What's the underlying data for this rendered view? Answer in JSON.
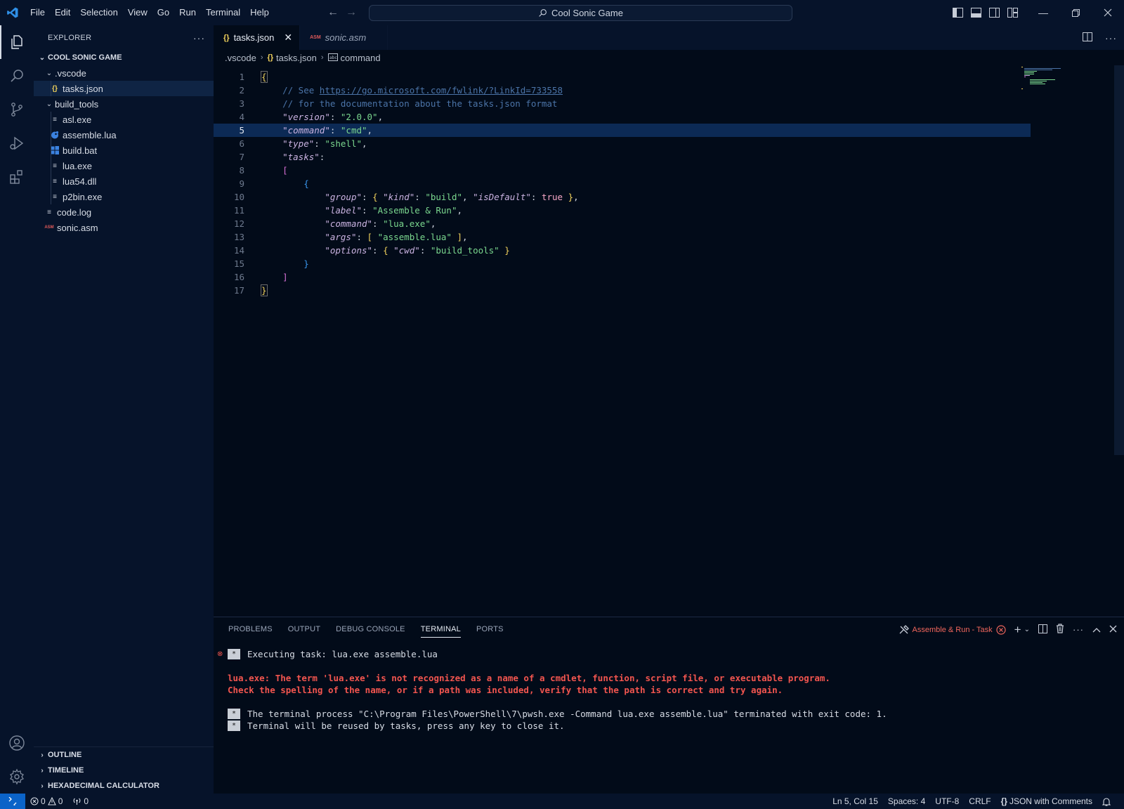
{
  "menu": [
    "File",
    "Edit",
    "Selection",
    "View",
    "Go",
    "Run",
    "Terminal",
    "Help"
  ],
  "command_center": "Cool Sonic Game",
  "sidebar": {
    "title": "EXPLORER",
    "more": "···",
    "folder": "COOL SONIC GAME",
    "tree": [
      {
        "label": ".vscode",
        "type": "folder"
      },
      {
        "label": "tasks.json",
        "type": "json"
      },
      {
        "label": "build_tools",
        "type": "folder"
      },
      {
        "label": "asl.exe",
        "type": "file"
      },
      {
        "label": "assemble.lua",
        "type": "lua"
      },
      {
        "label": "build.bat",
        "type": "bat"
      },
      {
        "label": "lua.exe",
        "type": "file"
      },
      {
        "label": "lua54.dll",
        "type": "file"
      },
      {
        "label": "p2bin.exe",
        "type": "file"
      },
      {
        "label": "code.log",
        "type": "file"
      },
      {
        "label": "sonic.asm",
        "type": "asm"
      }
    ],
    "sections": [
      "OUTLINE",
      "TIMELINE",
      "HEXADECIMAL CALCULATOR"
    ]
  },
  "tabs": [
    {
      "label": "tasks.json",
      "icon": "{}"
    },
    {
      "label": "sonic.asm",
      "icon": "ASM"
    }
  ],
  "breadcrumb": [
    ".vscode",
    "tasks.json",
    "command"
  ],
  "code": {
    "line_numbers": [
      "1",
      "2",
      "3",
      "4",
      "5",
      "6",
      "7",
      "8",
      "9",
      "10",
      "11",
      "12",
      "13",
      "14",
      "15",
      "16",
      "17"
    ],
    "l1": "{",
    "l2a": "// See ",
    "l2b": "https://go.microsoft.com/fwlink/?LinkId=733558",
    "l3": "// for the documentation about the tasks.json format",
    "l4k": "\"version\"",
    "l4v": "\"2.0.0\"",
    "l5k": "\"command\"",
    "l5v": "\"cmd\"",
    "l6k": "\"type\"",
    "l6v": "\"shell\"",
    "l7k": "\"tasks\"",
    "l8": "[",
    "l9": "{",
    "l10k": "\"group\"",
    "l10k2": "\"kind\"",
    "l10v2": "\"build\"",
    "l10k3": "\"isDefault\"",
    "l10v3": "true",
    "l11k": "\"label\"",
    "l11v": "\"Assemble & Run\"",
    "l12k": "\"command\"",
    "l12v": "\"lua.exe\"",
    "l13k": "\"args\"",
    "l13v": "\"assemble.lua\"",
    "l14k": "\"options\"",
    "l14k2": "\"cwd\"",
    "l14v2": "\"build_tools\"",
    "l15": "}",
    "l16": "]",
    "l17": "}"
  },
  "panel": {
    "tabs": [
      "PROBLEMS",
      "OUTPUT",
      "DEBUG CONSOLE",
      "TERMINAL",
      "PORTS"
    ],
    "task": "Assemble & Run - Task",
    "terminal": {
      "exec": "Executing task: lua.exe assemble.lua",
      "err1": "lua.exe: The term 'lua.exe' is not recognized as a name of a cmdlet, function, script file, or executable program.",
      "err2": "Check the spelling of the name, or if a path was included, verify that the path is correct and try again.",
      "info1": "The terminal process \"C:\\Program Files\\PowerShell\\7\\pwsh.exe -Command lua.exe assemble.lua\" terminated with exit code: 1.",
      "info2": "Terminal will be reused by tasks, press any key to close it."
    }
  },
  "status": {
    "errors": "0",
    "warnings": "0",
    "ports": "0",
    "position": "Ln 5, Col 15",
    "spaces": "Spaces: 4",
    "encoding": "UTF-8",
    "eol": "CRLF",
    "language": "JSON with Comments"
  },
  "colors": {
    "accent": "#0b63c8",
    "background": "#020b19",
    "sidebar": "#06132a",
    "error": "#f2554f"
  }
}
